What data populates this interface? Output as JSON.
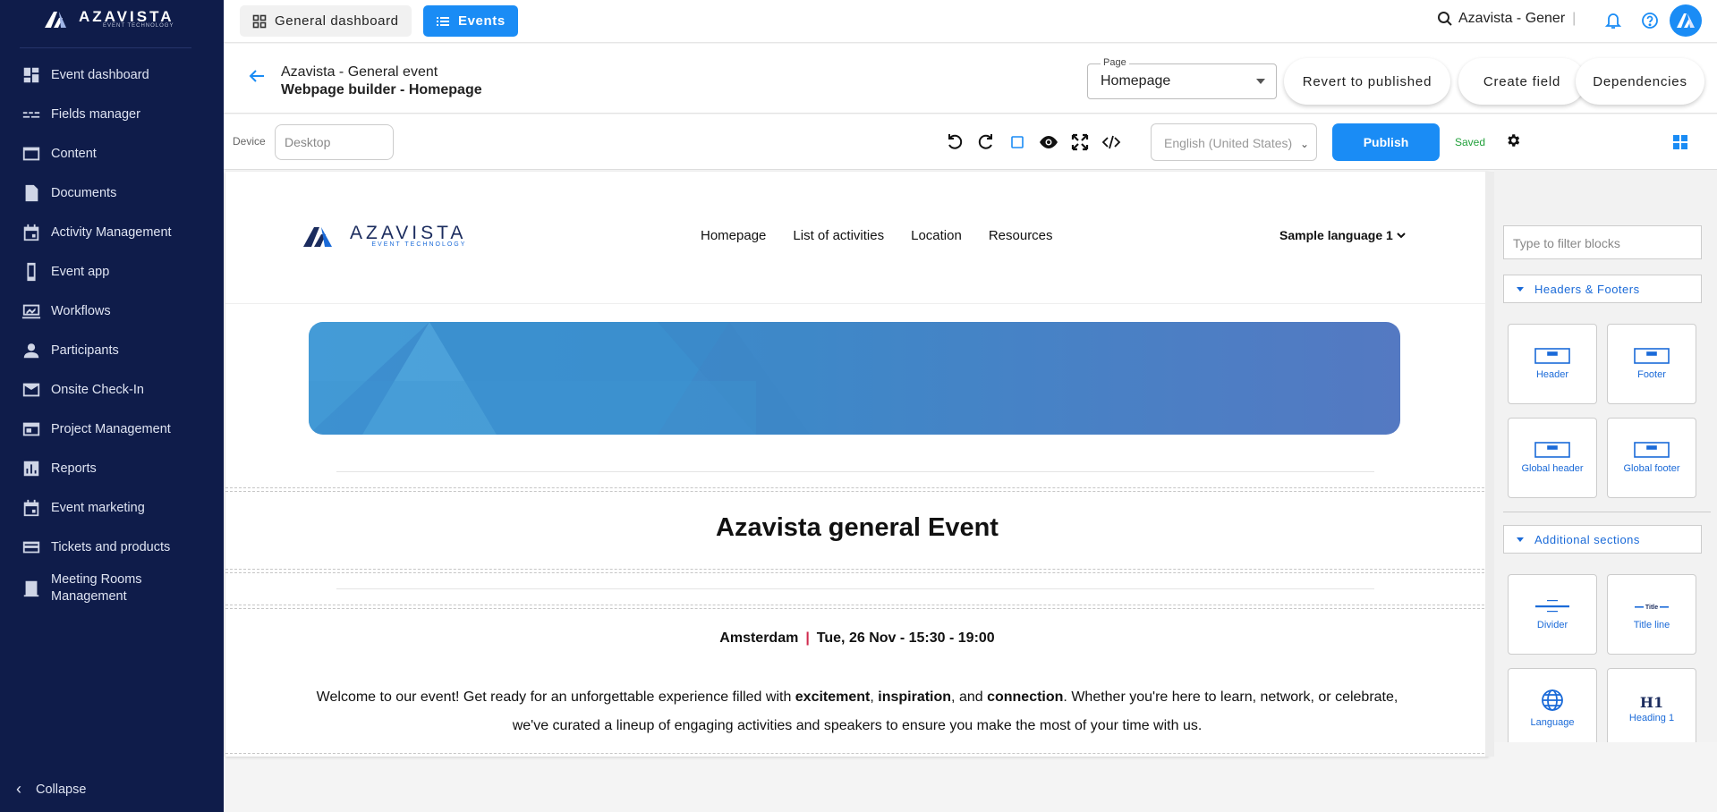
{
  "sidebar": {
    "brand": "AZAVISTA",
    "brand_sub": "EVENT TECHNOLOGY",
    "items": [
      {
        "label": "Event dashboard",
        "icon": "dashboard-icon"
      },
      {
        "label": "Fields manager",
        "icon": "fields-icon"
      },
      {
        "label": "Content",
        "icon": "content-icon"
      },
      {
        "label": "Documents",
        "icon": "document-icon"
      },
      {
        "label": "Activity Management",
        "icon": "calendar-icon"
      },
      {
        "label": "Event app",
        "icon": "phone-icon"
      },
      {
        "label": "Workflows",
        "icon": "workflow-icon"
      },
      {
        "label": "Participants",
        "icon": "person-icon"
      },
      {
        "label": "Onsite Check-In",
        "icon": "mail-icon"
      },
      {
        "label": "Project Management",
        "icon": "project-icon"
      },
      {
        "label": "Reports",
        "icon": "reports-icon"
      },
      {
        "label": "Event marketing",
        "icon": "calendar-icon"
      },
      {
        "label": "Tickets and products",
        "icon": "card-icon"
      },
      {
        "label": "Meeting Rooms Management",
        "icon": "door-icon"
      }
    ],
    "collapse": "Collapse"
  },
  "topbar": {
    "general_dashboard": "General dashboard",
    "events": "Events",
    "current_event": "Azavista - Gener"
  },
  "header": {
    "event_name": "Azavista - General event",
    "subtitle": "Webpage builder - Homepage",
    "page_legend": "Page",
    "page_value": "Homepage",
    "revert": "Revert to published",
    "create_field": "Create field",
    "dependencies": "Dependencies"
  },
  "toolbar": {
    "device_label": "Device",
    "device_value": "Desktop",
    "language": "English (United States)",
    "publish": "Publish",
    "saved": "Saved"
  },
  "canvas": {
    "brand": "AZAVISTA",
    "brand_sub": "EVENT TECHNOLOGY",
    "menu": [
      "Homepage",
      "List of activities",
      "Location",
      "Resources"
    ],
    "language": "Sample language 1",
    "title": "Azavista general Event",
    "city": "Amsterdam",
    "pipe": "|",
    "datetime": "Tue, 26 Nov - 15:30 - 19:00",
    "welcome": {
      "p1": "Welcome to our event! Get ready for an unforgettable experience filled with ",
      "b1": "excitement",
      "p2": ", ",
      "b2": "inspiration",
      "p3": ", and ",
      "b3": "connection",
      "p4": ". Whether you're here to learn, network, or celebrate, we've curated a lineup of engaging activities and speakers to ensure you make the most of your time with us."
    }
  },
  "blocks": {
    "filter_placeholder": "Type to filter blocks",
    "cat1": "Headers & Footers",
    "cat1_items": [
      "Header",
      "Footer",
      "Global header",
      "Global footer"
    ],
    "cat2": "Additional sections",
    "cat2_items": [
      "Divider",
      "Title line",
      "Language",
      "Heading 1"
    ],
    "title_line_glyph": "Title",
    "heading_glyph": "H1"
  },
  "colors": {
    "sidebar_bg": "#0f1c4a",
    "accent": "#1a8cf5",
    "saved_green": "#21a03a",
    "block_blue": "#1a6ad8"
  }
}
